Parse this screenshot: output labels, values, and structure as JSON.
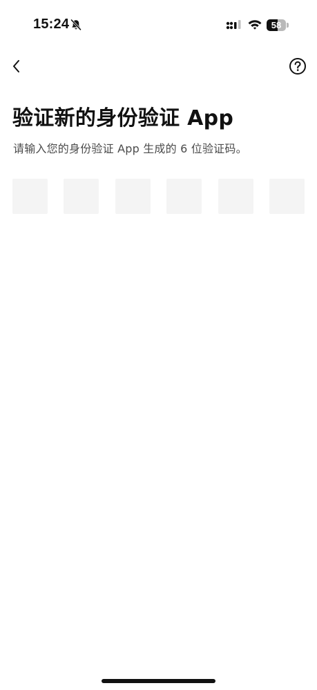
{
  "status_bar": {
    "time": "15:24",
    "battery_level": "58",
    "battery_fraction": 0.58,
    "icons": [
      "bell-off-icon",
      "signal-icon",
      "wifi-icon",
      "battery-icon"
    ]
  },
  "nav": {
    "back_icon": "chevron-left-icon",
    "help_icon": "question-circle-icon"
  },
  "page": {
    "title": "验证新的身份验证 App",
    "subtitle": "请输入您的身份验证 App 生成的 6 位验证码。"
  },
  "code_inputs": {
    "count": 6,
    "values": [
      "",
      "",
      "",
      "",
      "",
      ""
    ]
  },
  "colors": {
    "background": "#ffffff",
    "text_primary": "#111111",
    "text_secondary": "#4b4b4b",
    "input_fill": "#f4f4f4"
  }
}
